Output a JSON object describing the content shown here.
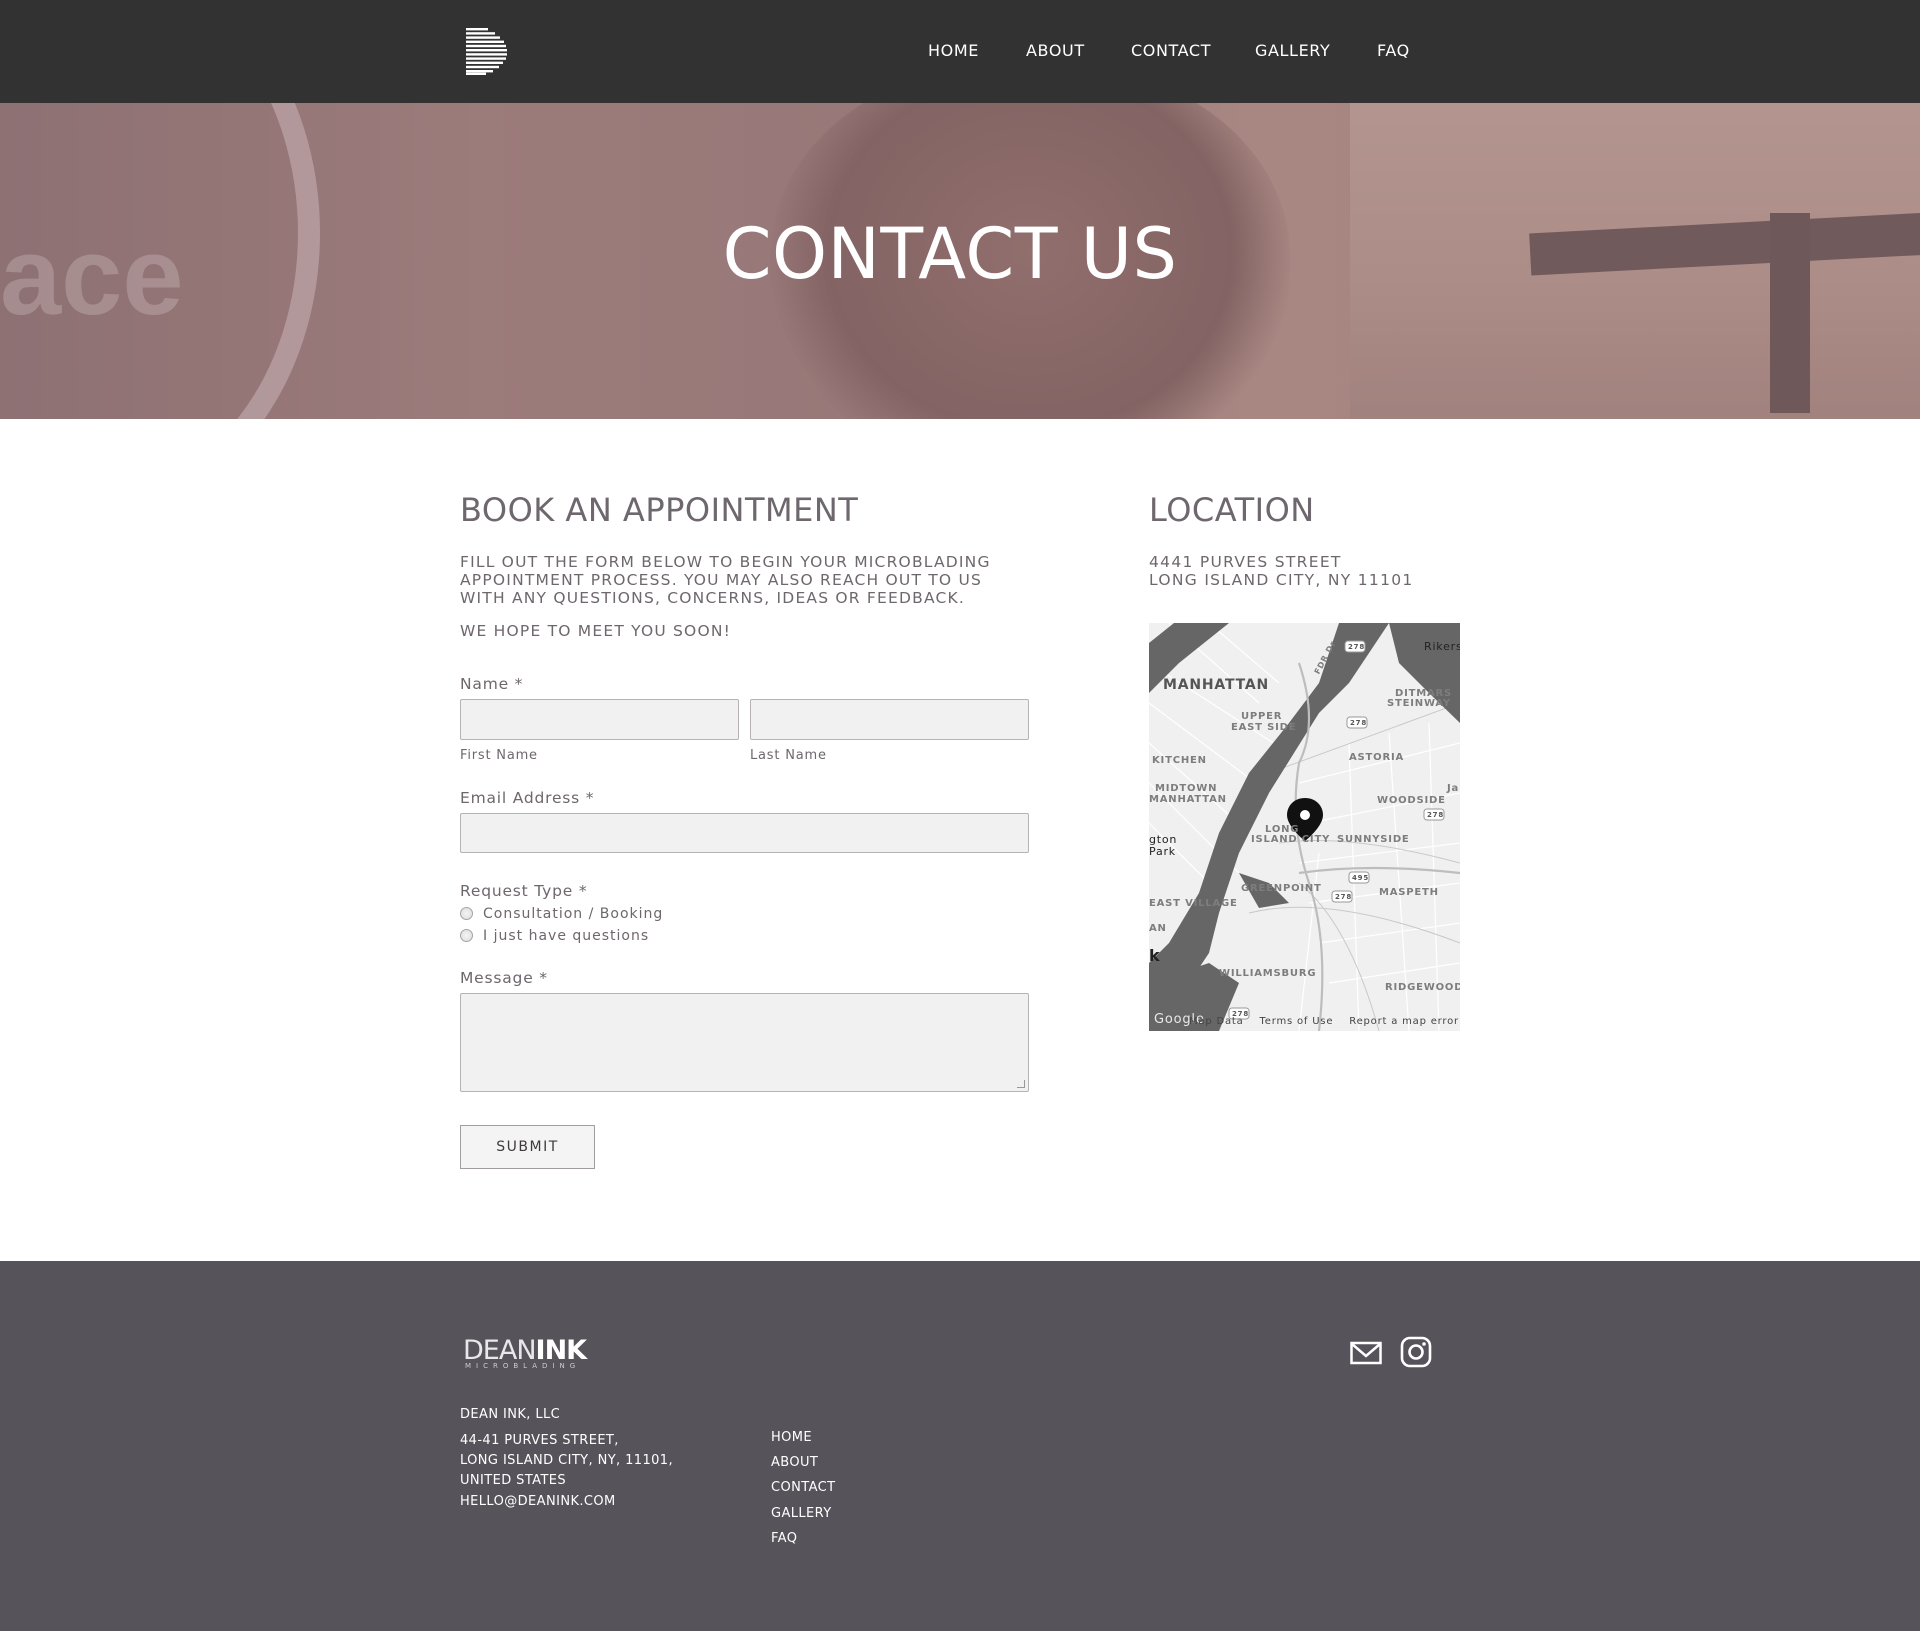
{
  "header": {
    "nav": [
      {
        "label": "HOME"
      },
      {
        "label": "ABOUT"
      },
      {
        "label": "CONTACT"
      },
      {
        "label": "GALLERY"
      },
      {
        "label": "FAQ"
      }
    ]
  },
  "hero": {
    "title": "CONTACT US",
    "background_text": "ace"
  },
  "booking": {
    "heading": "BOOK AN APPOINTMENT",
    "intro_lines": [
      "FILL OUT THE FORM BELOW TO BEGIN YOUR MICROBLADING",
      "APPOINTMENT PROCESS. YOU MAY ALSO REACH OUT TO US",
      "WITH ANY QUESTIONS, CONCERNS, IDEAS OR FEEDBACK."
    ],
    "closing": "WE HOPE TO MEET YOU SOON!",
    "name_label": "Name *",
    "first_name_label": "First Name",
    "last_name_label": "Last Name",
    "first_name_value": "",
    "last_name_value": "",
    "email_label": "Email Address *",
    "email_value": "",
    "request_label": "Request Type *",
    "request_options": [
      "Consultation / Booking",
      "I just have questions"
    ],
    "message_label": "Message *",
    "message_value": "",
    "submit_label": "SUBMIT"
  },
  "location": {
    "heading": "LOCATION",
    "address_line1": "4441 PURVES STREET",
    "address_line2": "LONG ISLAND CITY, NY 11101",
    "map": {
      "labels": [
        "MANHATTAN",
        "UPPER",
        "EAST SIDE",
        "DITMARS",
        "STEINWAY",
        "Rikers",
        "ASTORIA",
        "KITCHEN",
        "MIDTOWN",
        "MANHATTAN",
        "WOODSIDE",
        "LONG",
        "ISLAND CITY",
        "SUNNYSIDE",
        "gton",
        "Park",
        "GREENPOINT",
        "MASPETH",
        "EAST VILLAGE",
        "AN",
        "k",
        "WILLIAMSBURG",
        "RIDGEWOOD",
        "Ja",
        "FDR Dr"
      ],
      "shields": [
        "278",
        "278",
        "278",
        "278",
        "495",
        "278",
        "278"
      ],
      "footer": {
        "logo": "Google",
        "data": "Map Data",
        "terms": "Terms of Use",
        "report": "Report a map error"
      }
    }
  },
  "footer": {
    "brand_light": "DEAN",
    "brand_bold": "INK",
    "brand_sub": "MICROBLADING",
    "company": "DEAN INK, LLC",
    "address_lines": [
      "44-41 PURVES STREET,",
      "LONG ISLAND CITY, NY, 11101,",
      "UNITED STATES"
    ],
    "email": "HELLO@DEANINK.COM",
    "links": [
      {
        "label": "HOME"
      },
      {
        "label": "ABOUT"
      },
      {
        "label": "CONTACT"
      },
      {
        "label": "GALLERY"
      },
      {
        "label": "FAQ"
      }
    ],
    "icons": [
      "mail-icon",
      "instagram-icon"
    ]
  },
  "colors": {
    "header_bg": "#333233",
    "footer_bg": "#57535a",
    "heading_text": "#6e676d",
    "input_bg": "#f1f1f1"
  }
}
